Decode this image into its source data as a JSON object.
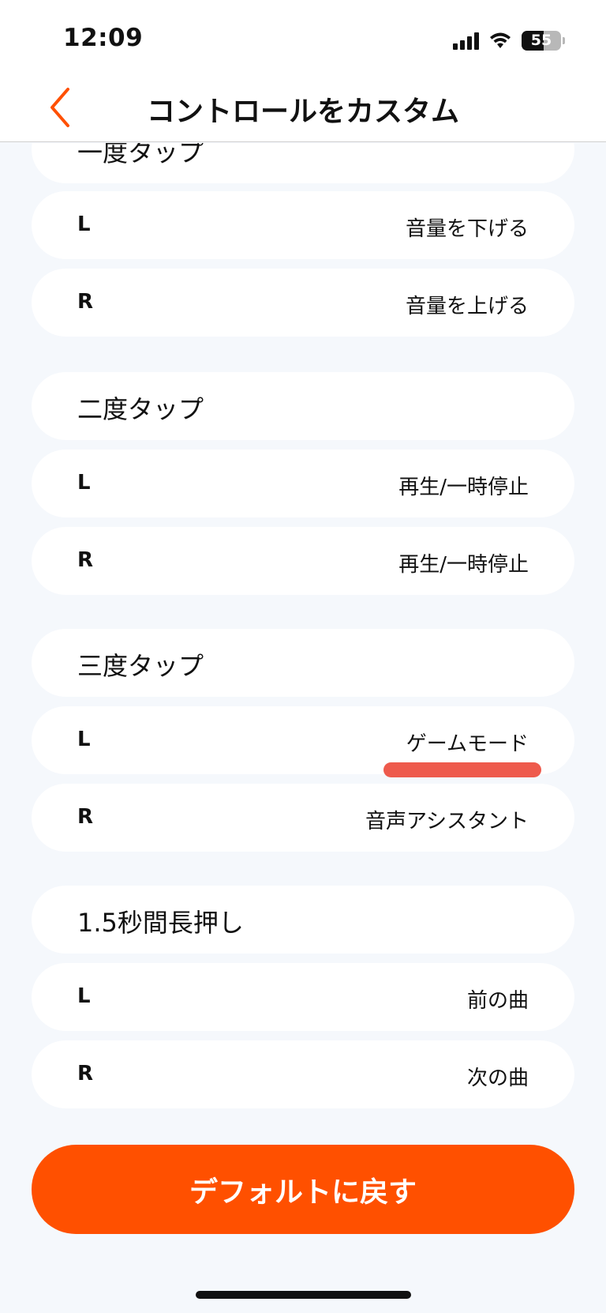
{
  "status": {
    "time": "12:09",
    "battery": "55",
    "battery_level": 0.55
  },
  "header": {
    "title": "コントロールをカスタム",
    "back_icon": "chevron-left-icon",
    "accent": "#ff5000"
  },
  "sections": [
    {
      "title": "一度タップ",
      "left": {
        "side": "L",
        "action": "音量を下げる"
      },
      "right": {
        "side": "R",
        "action": "音量を上げる"
      }
    },
    {
      "title": "二度タップ",
      "left": {
        "side": "L",
        "action": "再生/一時停止"
      },
      "right": {
        "side": "R",
        "action": "再生/一時停止"
      }
    },
    {
      "title": "三度タップ",
      "left": {
        "side": "L",
        "action": "ゲームモード"
      },
      "right": {
        "side": "R",
        "action": "音声アシスタント"
      }
    },
    {
      "title": "1.5秒間長押し",
      "left": {
        "side": "L",
        "action": "前の曲"
      },
      "right": {
        "side": "R",
        "action": "次の曲"
      }
    }
  ],
  "footer": {
    "reset_label": "デフォルトに戻す"
  },
  "annotation_color": "#ee5a4c"
}
